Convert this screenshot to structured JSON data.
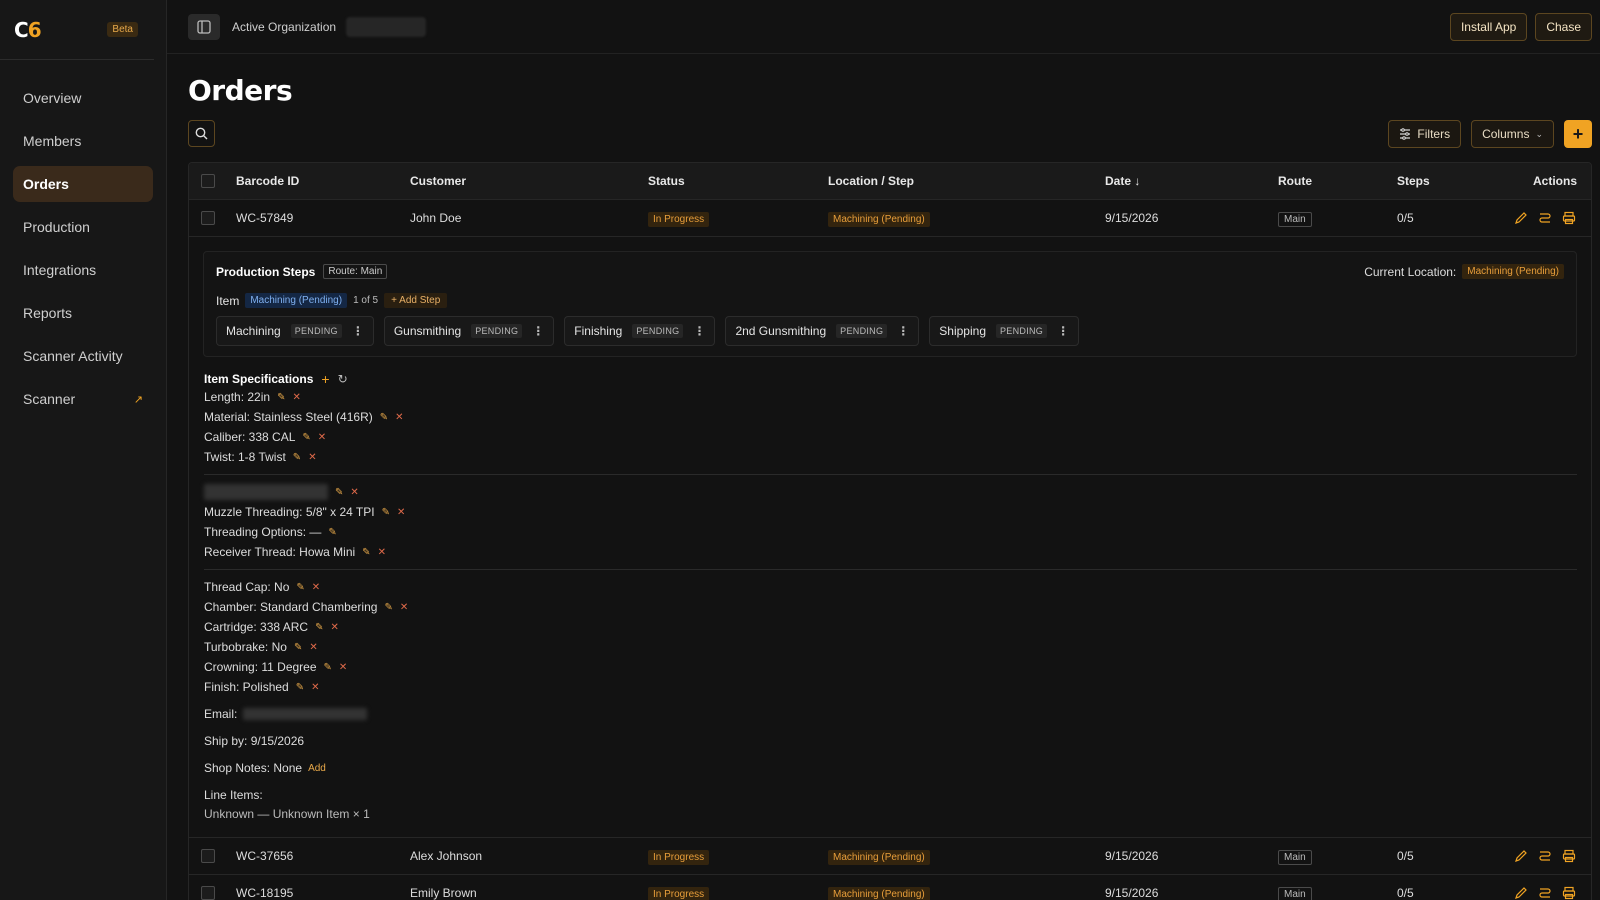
{
  "app": {
    "logo_left": "C",
    "logo_right": "6",
    "beta": "Beta"
  },
  "sidebar": {
    "items": [
      {
        "label": "Overview"
      },
      {
        "label": "Members"
      },
      {
        "label": "Orders",
        "active": true
      },
      {
        "label": "Production"
      },
      {
        "label": "Integrations"
      },
      {
        "label": "Reports"
      },
      {
        "label": "Scanner Activity"
      },
      {
        "label": "Scanner",
        "external": true
      }
    ]
  },
  "topbar": {
    "org_label": "Active Organization",
    "org_value": "",
    "install_app": "Install App",
    "user": "Chase"
  },
  "page": {
    "title": "Orders",
    "filters": "Filters",
    "columns": "Columns",
    "add": "+"
  },
  "table": {
    "headers": {
      "barcode": "Barcode ID",
      "customer": "Customer",
      "status": "Status",
      "location": "Location / Step",
      "date": "Date ↓",
      "route": "Route",
      "steps": "Steps",
      "actions": "Actions"
    },
    "rows": [
      {
        "barcode": "WC-57849",
        "customer": "John Doe",
        "status": "In Progress",
        "location": "Machining (Pending)",
        "date": "9/15/2026",
        "route": "Main",
        "steps": "0/5"
      },
      {
        "barcode": "WC-37656",
        "customer": "Alex Johnson",
        "status": "In Progress",
        "location": "Machining (Pending)",
        "date": "9/15/2026",
        "route": "Main",
        "steps": "0/5"
      },
      {
        "barcode": "WC-18195",
        "customer": "Emily Brown",
        "status": "In Progress",
        "location": "Machining (Pending)",
        "date": "9/15/2026",
        "route": "Main",
        "steps": "0/5"
      }
    ]
  },
  "detail": {
    "steps_title": "Production Steps",
    "route_tag": "Route: Main",
    "current_location_label": "Current Location:",
    "current_location_value": "Machining (Pending)",
    "item_label": "Item",
    "item_status": "Machining (Pending)",
    "item_count": "1 of 5",
    "add_step": "+ Add Step",
    "steps": [
      {
        "name": "Machining",
        "state": "PENDING"
      },
      {
        "name": "Gunsmithing",
        "state": "PENDING"
      },
      {
        "name": "Finishing",
        "state": "PENDING"
      },
      {
        "name": "2nd Gunsmithing",
        "state": "PENDING"
      },
      {
        "name": "Shipping",
        "state": "PENDING"
      }
    ],
    "specs_title": "Item Specifications",
    "specs_group1": [
      "Length: 22in",
      "Material: Stainless Steel (416R)",
      "Caliber: 338 CAL",
      "Twist: 1-8 Twist"
    ],
    "specs_group2": [
      "Muzzle Threading: 5/8\" x 24 TPI",
      "Threading Options: —",
      "Receiver Thread: Howa Mini"
    ],
    "specs_group3": [
      "Thread Cap: No",
      "Chamber: Standard Chambering",
      "Cartridge: 338 ARC",
      "Turbobrake: No",
      "Crowning: 11 Degree",
      "Finish: Polished"
    ],
    "email_label": "Email:",
    "ship_by": "Ship by: 9/15/2026",
    "shop_notes": "Shop Notes: None",
    "shop_notes_add": "Add",
    "line_items_label": "Line Items:",
    "line_items_value": "Unknown — Unknown Item × 1"
  },
  "colors": {
    "accent": "#f0a323",
    "background": "#121212",
    "sidebar": "#171717",
    "active_nav": "#3a2a1b"
  }
}
